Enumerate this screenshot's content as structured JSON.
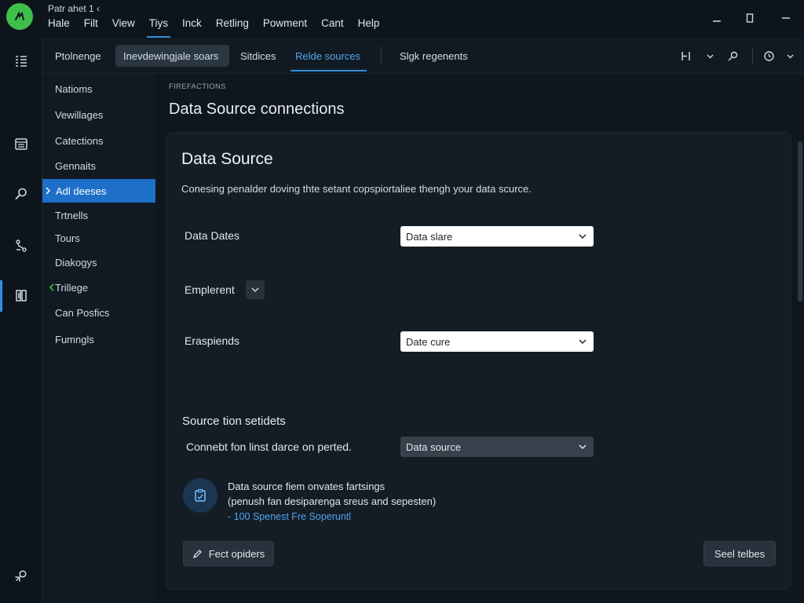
{
  "window": {
    "title": "Patr ahet 1 ‹",
    "menu": [
      "Hale",
      "Filt",
      "View",
      "Tiys",
      "Inck",
      "Retling",
      "Powment",
      "Cant",
      "Help"
    ],
    "active_menu": "Tiys"
  },
  "tabs": {
    "items": [
      {
        "label": "Ptolnenge"
      },
      {
        "label": "Inevdewingjale soars"
      },
      {
        "label": "Sitdices"
      },
      {
        "label": "Relde sources"
      },
      {
        "label": "Slgk regenents"
      }
    ],
    "active": "Relde sources"
  },
  "sidebar": {
    "items": [
      {
        "label": "Natioms"
      },
      {
        "label": "Vewillages"
      },
      {
        "label": "Catections"
      },
      {
        "label": "Gennaits"
      },
      {
        "label": "Adl deeses"
      },
      {
        "label": "Trtnells"
      },
      {
        "label": "Tours"
      },
      {
        "label": "Diakogys"
      },
      {
        "label": "Trillege"
      },
      {
        "label": "Can Posfics"
      },
      {
        "label": "Fumngls"
      }
    ],
    "active": "Adl deeses"
  },
  "breadcrumb": "FIREFACTIONS",
  "page_title": "Data Source connections",
  "card": {
    "title": "Data Source",
    "description": "Conesing penalder doving thte setant copspiortaliee thengh your data scurce.",
    "fields": [
      {
        "label": "Data Dates",
        "value": "Data slare"
      },
      {
        "label": "Emplerent",
        "value": ""
      },
      {
        "label": "Eraspiends",
        "value": "Date cure"
      }
    ],
    "section": {
      "title": "Source tion setidets",
      "row_label": "Connebt fon linst darce on perted.",
      "row_value": "Data source"
    },
    "info": {
      "line1": "Data source fiem onvates fartsings",
      "line2": "(penush fan desiparenga sreus and sepesten)",
      "link": "- 100 Spenest Fre Soperuntl"
    },
    "buttons": {
      "left": "Fect opiders",
      "right": "Seel telbes"
    }
  },
  "colors": {
    "accent": "#2f8fe0",
    "logo": "#3fbf4a",
    "background": "#0f161d"
  }
}
